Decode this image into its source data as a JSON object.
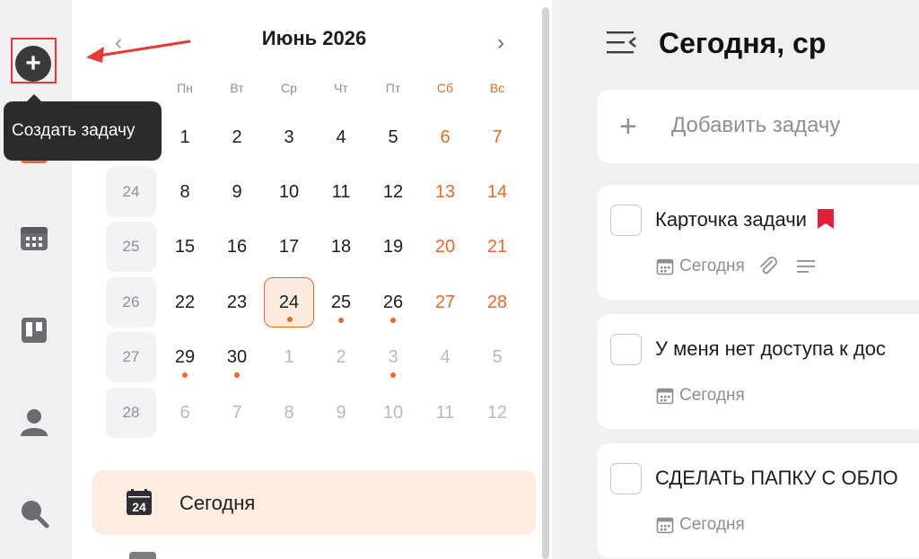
{
  "tooltip": {
    "text": "Создать задачу"
  },
  "calendar": {
    "title": "Июнь 2026",
    "weekdays": [
      "Пн",
      "Вт",
      "Ср",
      "Чт",
      "Пт",
      "Сб",
      "Вс"
    ],
    "week_numbers": [
      "24",
      "25",
      "26",
      "27",
      "28"
    ],
    "weeks": [
      [
        "1",
        "2",
        "3",
        "4",
        "5",
        "6",
        "7"
      ],
      [
        "8",
        "9",
        "10",
        "11",
        "12",
        "13",
        "14"
      ],
      [
        "15",
        "16",
        "17",
        "18",
        "19",
        "20",
        "21"
      ],
      [
        "22",
        "23",
        "24",
        "25",
        "26",
        "27",
        "28"
      ],
      [
        "29",
        "30",
        "1",
        "2",
        "3",
        "4",
        "5"
      ],
      [
        "6",
        "7",
        "8",
        "9",
        "10",
        "11",
        "12"
      ]
    ],
    "selected_day": "24",
    "today_nav_label": "Сегодня",
    "today_icon_number": "24"
  },
  "main": {
    "title": "Сегодня, ср",
    "add_task_placeholder": "Добавить задачу",
    "tasks": [
      {
        "title": "Карточка задачи",
        "due": "Сегодня",
        "flagged": true
      },
      {
        "title": "У меня нет доступа к дос",
        "due": "Сегодня"
      },
      {
        "title": "СДЕЛАТЬ ПАПКУ С ОБЛО",
        "due": "Сегодня"
      }
    ]
  },
  "colors": {
    "accent": "#e8692c",
    "highlight": "#e53935",
    "flag": "#e01f3d"
  }
}
